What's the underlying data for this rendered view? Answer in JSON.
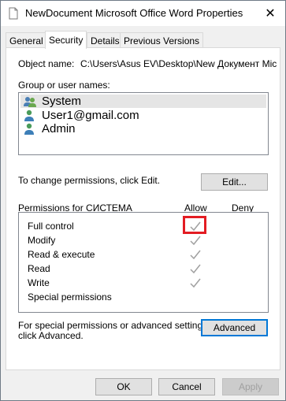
{
  "window": {
    "title": "NewDocument Microsoft Office Word Properties",
    "close_label": "✕"
  },
  "tabs": [
    {
      "label": "General",
      "active": false
    },
    {
      "label": "Security",
      "active": true
    },
    {
      "label": "Details",
      "active": false
    },
    {
      "label": "Previous Versions",
      "active": false
    }
  ],
  "security": {
    "object_name_label": "Object name:",
    "object_name_value": "C:\\Users\\Asus EV\\Desktop\\New Документ Micro",
    "groups_label": "Group or user names:",
    "users": [
      {
        "name": "System",
        "icon": "users-group-icon",
        "selected": true
      },
      {
        "name": "User1@gmail.com",
        "icon": "user-icon",
        "selected": false
      },
      {
        "name": "Admin",
        "icon": "user-icon",
        "selected": false
      }
    ],
    "change_text": "To change permissions, click Edit.",
    "edit_button": "Edit...",
    "permissions_label": "Permissions for СИСТЕМА",
    "allow_header": "Allow",
    "deny_header": "Deny",
    "permissions": [
      {
        "name": "Full control",
        "allow": true,
        "deny": false
      },
      {
        "name": "Modify",
        "allow": true,
        "deny": false
      },
      {
        "name": "Read & execute",
        "allow": true,
        "deny": false
      },
      {
        "name": "Read",
        "allow": true,
        "deny": false
      },
      {
        "name": "Write",
        "allow": true,
        "deny": false
      },
      {
        "name": "Special permissions",
        "allow": false,
        "deny": false
      }
    ],
    "advanced_text_1": "For special permissions or advanced settings,",
    "advanced_text_2": "click Advanced.",
    "advanced_button": "Advanced"
  },
  "footer": {
    "ok": "OK",
    "cancel": "Cancel",
    "apply": "Apply"
  },
  "colors": {
    "highlight": "#e31c23",
    "check_gray": "#a0a0a0",
    "focus_blue": "#0078d7"
  }
}
